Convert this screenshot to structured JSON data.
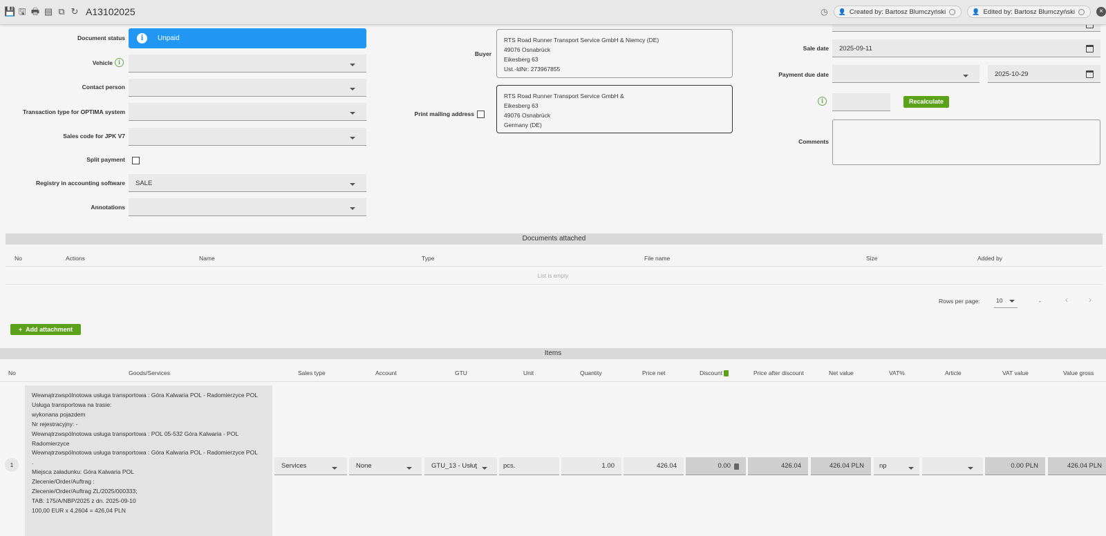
{
  "topbar": {
    "title": "A13102025",
    "icons": [
      "save-icon",
      "save-close-icon",
      "print-icon",
      "preview-icon",
      "copy-icon",
      "refresh-icon"
    ],
    "created_by": "Created by: Bartosz Blumczyński",
    "edited_by": "Edited by: Bartosz Blumczyński"
  },
  "form": {
    "document_status_label": "Document status",
    "document_status_value": "Unpaid",
    "vehicle_label": "Vehicle",
    "contact_person_label": "Contact person",
    "transaction_type_label": "Transaction type for OPTIMA system",
    "sales_code_label": "Sales code for JPK V7",
    "split_payment_label": "Split payment",
    "registry_label": "Registry in accounting software",
    "registry_value": "SALE",
    "annotations_label": "Annotations",
    "buyer_label": "Buyer",
    "buyer_lines": [
      "RTS Road Runner Transport Service GmbH & Niemcy (DE)",
      "49076 Osnabrück",
      "Eikesberg 63",
      "Ust.-IdNr: 273967855"
    ],
    "print_mailing_label": "Print mailing address",
    "mailing_lines": [
      "RTS Road Runner Transport Service GmbH &",
      "Eikesberg 63",
      "49076 Osnabrück",
      "Germany (DE)"
    ],
    "sale_date_label": "Sale date",
    "sale_date_value": "2025-09-11",
    "payment_due_label": "Payment due date",
    "payment_due_value": "2025-10-29",
    "recalculate_label": "Recalculate",
    "comments_label": "Comments"
  },
  "documents": {
    "title": "Documents attached",
    "columns": [
      "No",
      "Actions",
      "Name",
      "Type",
      "File name",
      "Size",
      "Added by"
    ],
    "empty_text": "List is empty",
    "rows_per_page_label": "Rows per page:",
    "rows_per_page_value": "10",
    "range_text": "-",
    "add_attachment_label": "Add attachment"
  },
  "items": {
    "title": "Items",
    "columns": [
      "No",
      "Goods/Services",
      "Sales type",
      "Account",
      "GTU",
      "Unit",
      "Quantity",
      "Price net",
      "Discount",
      "Price after discount",
      "Net value",
      "VAT%",
      "Article",
      "VAT value",
      "Value gross"
    ],
    "row": {
      "no": "1",
      "goods_lines": [
        "Wewnątrzwspólnotowa usługa transportowa : Góra Kalwaria POL - Radomierzyce POL",
        "Usługa transportowa na trasie:",
        "wykonana pojazdem",
        "Nr rejestracyjny:  -",
        "Wewnątrzwspólnotowa usługa transportowa : POL 05-532 Góra Kalwaria - POL",
        "Radomierzyce",
        "Wewnątrzwspólnotowa usługa transportowa : Góra Kalwaria POL - Radomierzyce POL",
        ".",
        "Miejsca załadunku: Góra Kalwaria POL",
        "Zlecenie/Order/Auftrag :",
        "Zlecenie/Order/Auftrag ZL/2025/000333;",
        "TAB: 175/A/NBP/2025 z dn. 2025-09-10",
        "100,00 EUR x 4,2604 = 426,04 PLN"
      ],
      "sales_type": "Services",
      "account": "None",
      "gtu": "GTU_13 - Usłuţ",
      "unit": "pcs.",
      "quantity": "1.00",
      "price_net": "426.04",
      "discount": "0.00",
      "price_after_discount": "426.04",
      "net_value": "426.04 PLN",
      "vat": "np",
      "vat_value": "0.00 PLN",
      "value_gross": "426.04 PLN"
    }
  },
  "colors": {
    "status_blue": "#2196f3",
    "action_green": "#5aa21a"
  }
}
